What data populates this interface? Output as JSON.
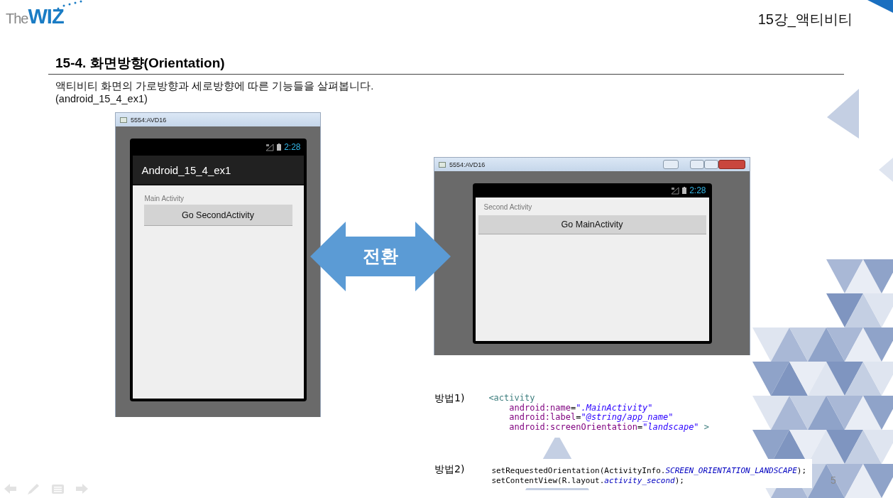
{
  "header": {
    "logo_prefix": "The",
    "logo_main": "WIZ",
    "chapter": "15강_액티비티"
  },
  "slide": {
    "title": "15-4. 화면방향(Orientation)",
    "description": "액티비티 화면의 가로방향과 세로방향에 따른 기능들을 살펴봅니다.",
    "project": "(android_15_4_ex1)"
  },
  "emulators": [
    {
      "kind": "portrait",
      "window_title": "5554:AVD16",
      "time": "2:28",
      "app_title": "Android_15_4_ex1",
      "label": "Main Activity",
      "button": "Go SecondActivity"
    },
    {
      "kind": "landscape",
      "window_title": "5554:AVD16",
      "time": "2:28",
      "label": "Second Activity",
      "button": "Go MainActivity"
    }
  ],
  "switch_arrow": {
    "label": "전환"
  },
  "methods": [
    {
      "label": "방법1)",
      "kind": "xml",
      "lines": [
        [
          {
            "kind": "tag",
            "text": "<activity"
          }
        ],
        [
          {
            "kind": "attr",
            "text": "    android:name"
          },
          {
            "kind": "plain",
            "text": "="
          },
          {
            "kind": "string",
            "text": "\".MainActivity\""
          }
        ],
        [
          {
            "kind": "attr",
            "text": "    android:label"
          },
          {
            "kind": "plain",
            "text": "="
          },
          {
            "kind": "string",
            "text": "\"@string/app_name\""
          }
        ],
        [
          {
            "kind": "attr",
            "text": "    android:screenOrientation"
          },
          {
            "kind": "plain",
            "text": "="
          },
          {
            "kind": "string",
            "text": "\"landscape\""
          },
          {
            "kind": "tag",
            "text": " >"
          }
        ]
      ]
    },
    {
      "label": "방법2)",
      "kind": "java",
      "lines": [
        [
          {
            "kind": "plain",
            "text": "setRequestedOrientation(ActivityInfo."
          },
          {
            "kind": "const",
            "text": "SCREEN_ORIENTATION_LANDSCAPE"
          },
          {
            "kind": "plain",
            "text": ");"
          }
        ],
        [
          {
            "kind": "plain",
            "text": "setContentView(R.layout."
          },
          {
            "kind": "const",
            "text": "activity_second"
          },
          {
            "kind": "plain",
            "text": ");"
          }
        ]
      ]
    }
  ],
  "page_number": "5"
}
